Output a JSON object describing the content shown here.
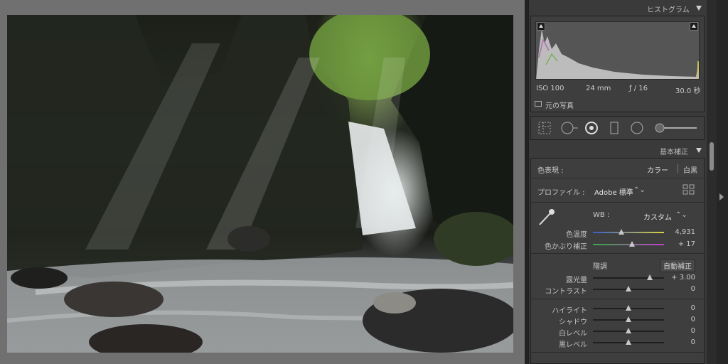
{
  "histogram": {
    "title": "ヒストグラム",
    "iso": "ISO 100",
    "focal_length": "24 mm",
    "aperture": "ƒ / 16",
    "shutter": "30.0 秒",
    "original_photo_label": "元の写真"
  },
  "tools": [
    "crop-icon",
    "spot-removal-icon",
    "red-eye-icon",
    "graduated-filter-icon",
    "radial-filter-icon",
    "adjustment-brush-icon"
  ],
  "basic": {
    "title": "基本補正",
    "treatment_label": "色表現 :",
    "treatment_color": "カラー",
    "treatment_bw": "白黒",
    "profile_label": "プロファイル :",
    "profile_value": "Adobe 標準",
    "wb_label": "WB :",
    "wb_value": "カスタム",
    "temp_label": "色温度",
    "temp_value": "4,931",
    "temp_level": 0.4,
    "tint_label": "色かぶり補正",
    "tint_value": "+ 17",
    "tint_level": 0.55,
    "tone_label": "階調",
    "auto_label": "自動補正",
    "sliders": [
      {
        "label": "露光量",
        "value": "+ 3.00",
        "level": 0.8
      },
      {
        "label": "コントラスト",
        "value": "0",
        "level": 0.5
      }
    ],
    "presence": [
      {
        "label": "ハイライト",
        "value": "0",
        "level": 0.5
      },
      {
        "label": "シャドウ",
        "value": "0",
        "level": 0.5
      },
      {
        "label": "白レベル",
        "value": "0",
        "level": 0.5
      },
      {
        "label": "黒レベル",
        "value": "0",
        "level": 0.5
      }
    ]
  }
}
